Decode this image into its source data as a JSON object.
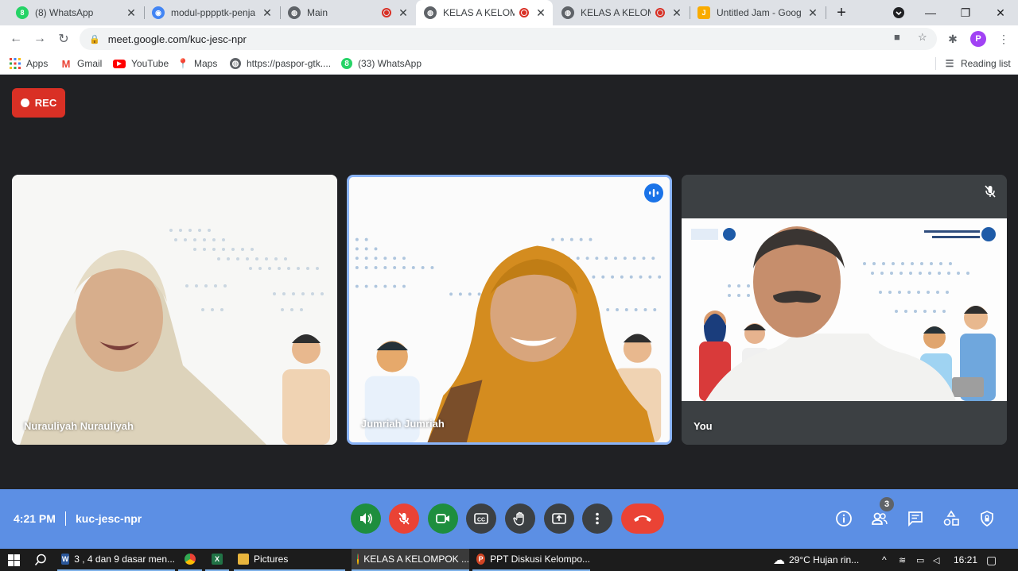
{
  "browser": {
    "tabs": [
      {
        "title": "(8) WhatsApp",
        "icon": "whatsapp-icon",
        "badge": "8",
        "color": "#25d366",
        "recording": false
      },
      {
        "title": "modul-pppptk-penjas",
        "icon": "drive-icon",
        "badge": "",
        "color": "#4285f4",
        "recording": false
      },
      {
        "title": "Main",
        "icon": "globe-icon",
        "badge": "",
        "color": "#5f6368",
        "recording": true
      },
      {
        "title": "KELAS A KELOMPOK",
        "icon": "globe-icon",
        "badge": "",
        "color": "#5f6368",
        "recording": true
      },
      {
        "title": "KELAS A KELOMPOK",
        "icon": "globe-icon",
        "badge": "",
        "color": "#5f6368",
        "recording": true
      },
      {
        "title": "Untitled Jam - Google",
        "icon": "jamboard-icon",
        "badge": "",
        "color": "#f9ab00",
        "recording": false
      }
    ],
    "url": "meet.google.com/kuc-jesc-npr",
    "profile_initial": "P",
    "bookmarks": [
      {
        "label": "Apps",
        "icon": "apps-grid-icon"
      },
      {
        "label": "Gmail",
        "icon": "gmail-icon"
      },
      {
        "label": "YouTube",
        "icon": "youtube-icon"
      },
      {
        "label": "Maps",
        "icon": "maps-icon"
      },
      {
        "label": "https://paspor-gtk....",
        "icon": "globe-icon"
      },
      {
        "label": "(33) WhatsApp",
        "icon": "whatsapp-icon"
      }
    ],
    "reading_list": "Reading list"
  },
  "meet": {
    "rec_label": "REC",
    "participants": [
      {
        "name": "Nurauliyah Nurauliyah"
      },
      {
        "name": "Jumriah Jumriah"
      },
      {
        "name": "You"
      }
    ],
    "bottombar": {
      "time": "4:21 PM",
      "meeting_code": "kuc-jesc-npr",
      "people_count": "3"
    },
    "colors": {
      "accent": "#5c8fe4",
      "red": "#ea4335",
      "green": "#1e8e3e",
      "speaking": "#8ab4f8"
    }
  },
  "taskbar": {
    "items": [
      {
        "label": "3 , 4 dan 9  dasar men...",
        "icon": "word-icon"
      },
      {
        "label": "",
        "icon": "chrome-icon"
      },
      {
        "label": "",
        "icon": "excel-icon"
      },
      {
        "label": "Pictures",
        "icon": "folder-icon"
      },
      {
        "label": "KELAS A KELOMPOK ...",
        "icon": "chrome-icon"
      },
      {
        "label": "PPT Diskusi Kelompo...",
        "icon": "powerpoint-icon"
      }
    ],
    "weather": "29°C  Hujan rin...",
    "clock": "16:21"
  }
}
